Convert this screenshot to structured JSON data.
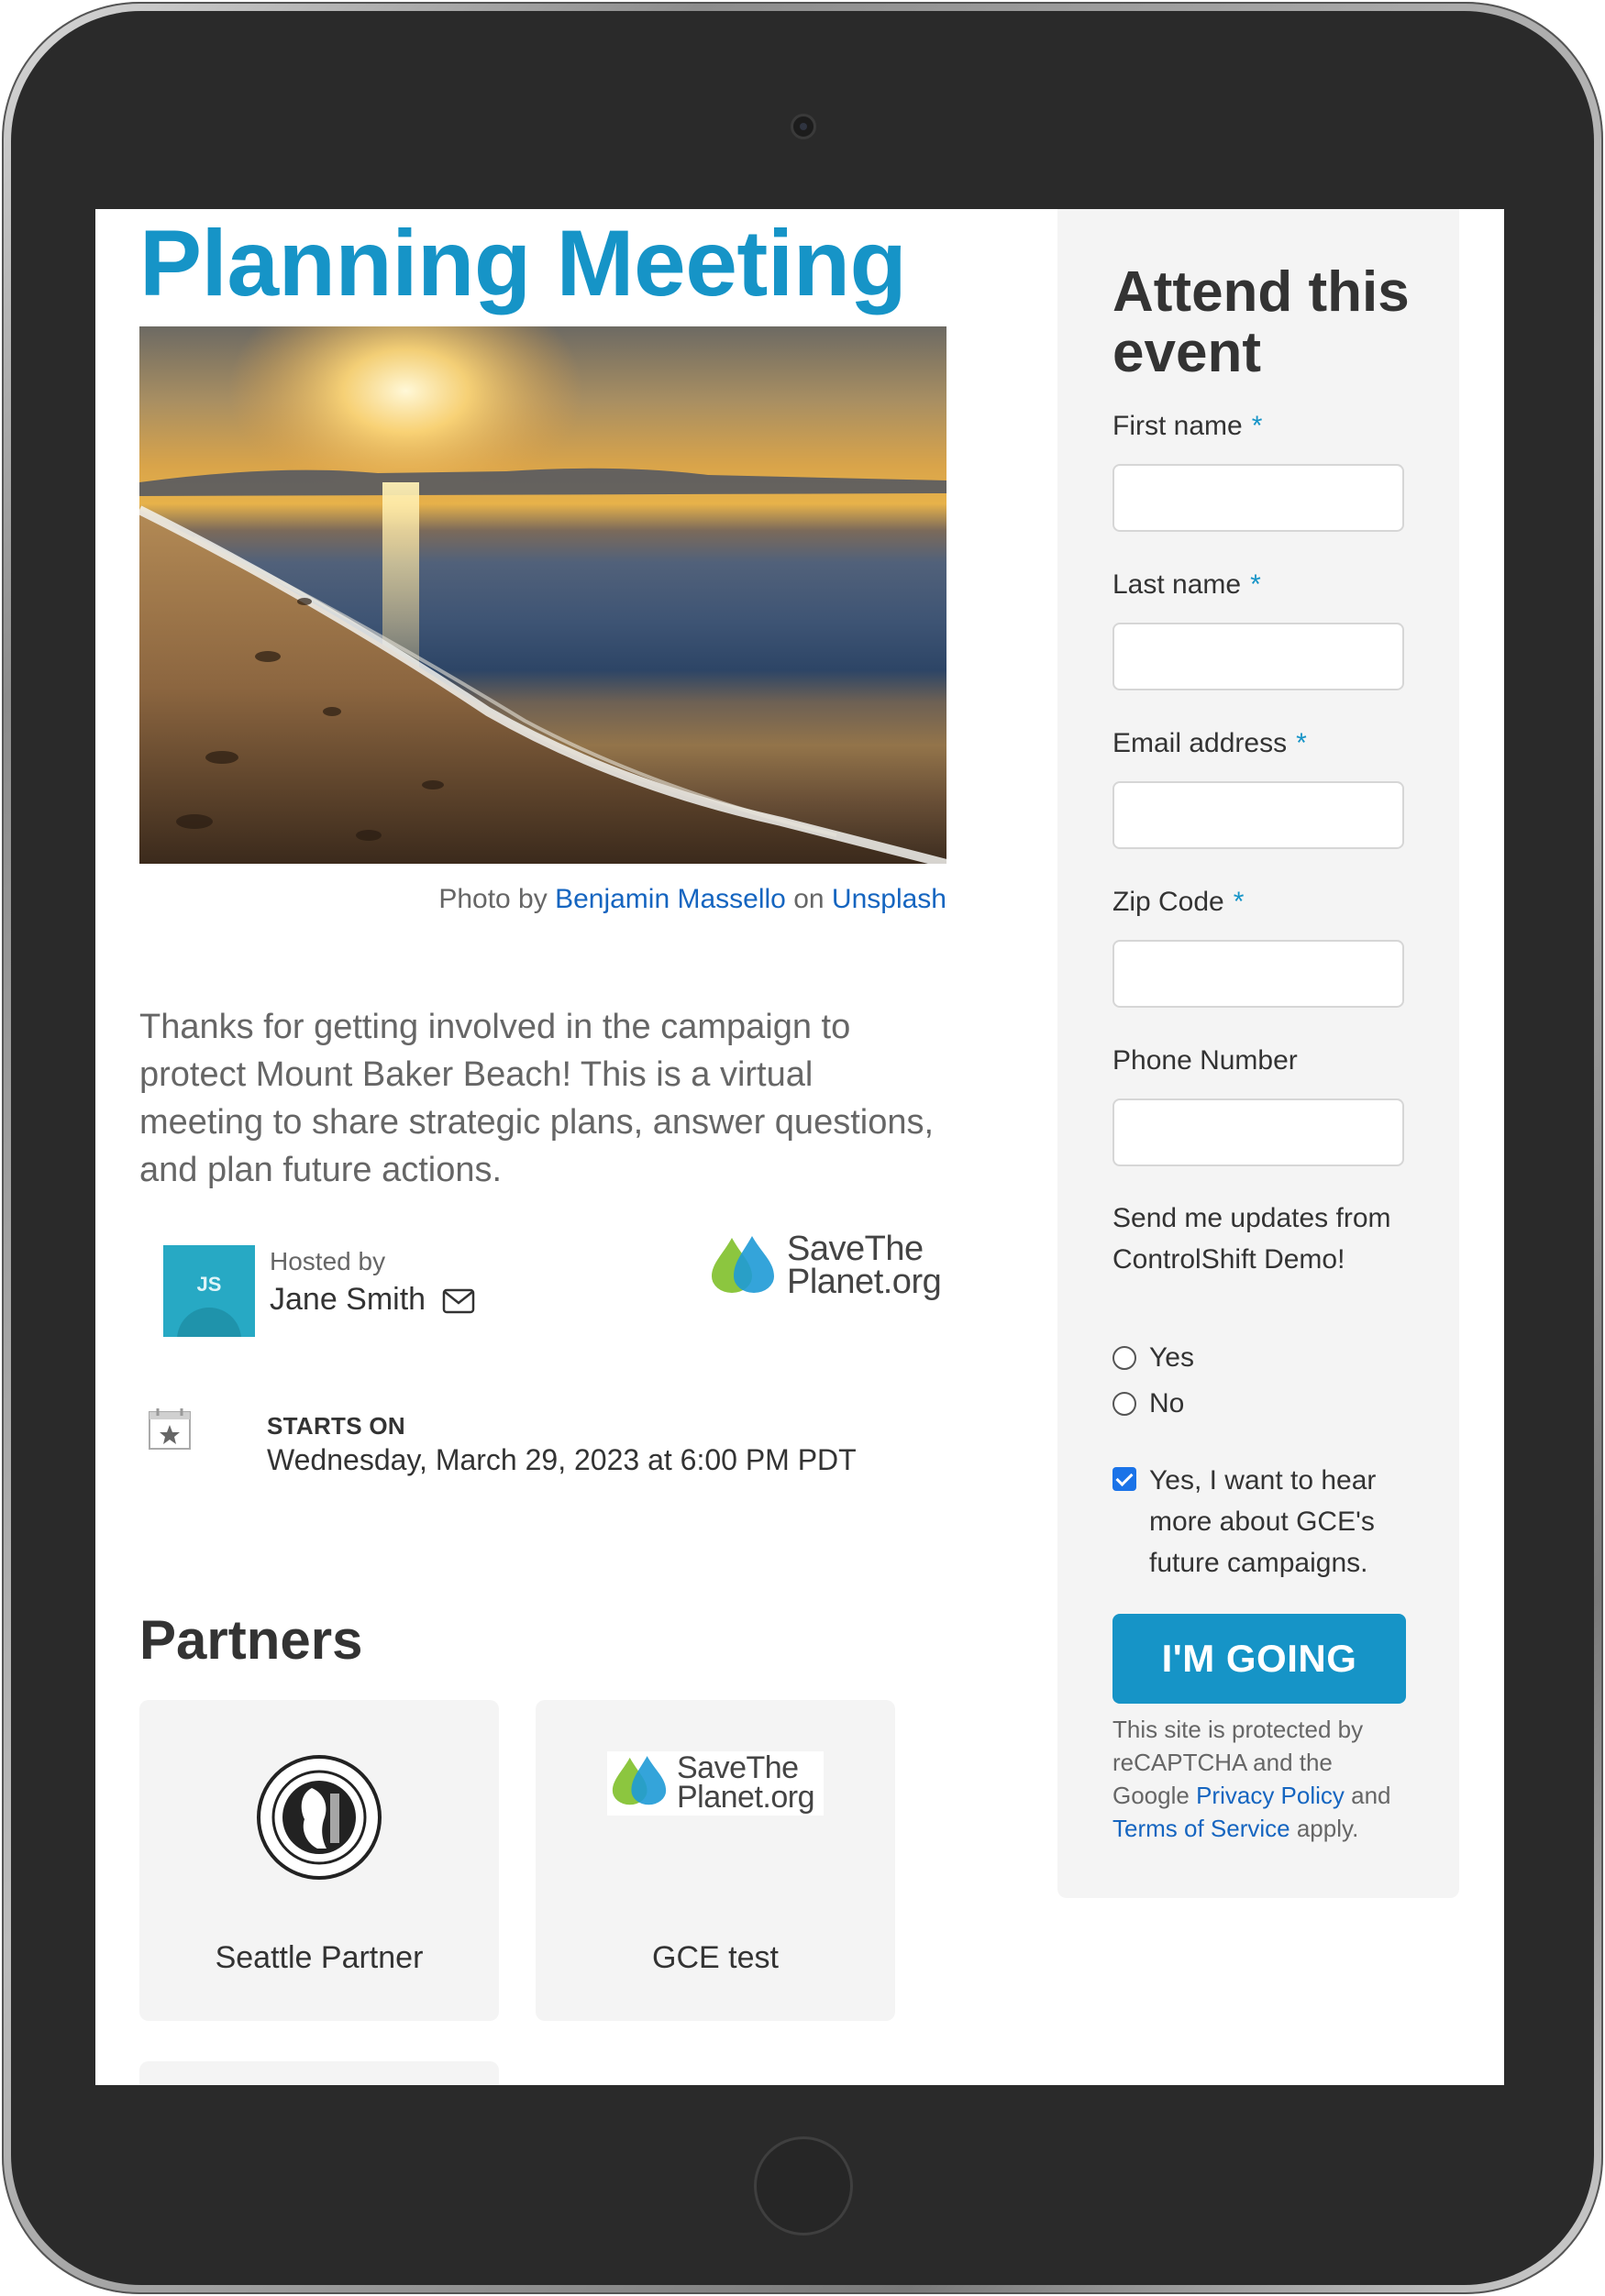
{
  "event": {
    "title": "Planning Meeting",
    "photo_credit": {
      "prefix": "Photo by",
      "photographer": "Benjamin Massello",
      "connector": "on",
      "source": "Unsplash"
    },
    "description": "Thanks for getting involved in the campaign to protect Mount Baker Beach! This is a virtual meeting to share strategic plans, answer questions, and plan future actions.",
    "host": {
      "label": "Hosted by",
      "initials": "JS",
      "name": "Jane Smith"
    },
    "organization_logo": {
      "line1": "SaveThe",
      "line2": "Planet.org"
    },
    "schedule": {
      "label": "STARTS ON",
      "value": "Wednesday, March 29, 2023 at 6:00 PM PDT"
    }
  },
  "partners": {
    "heading": "Partners",
    "items": [
      {
        "name": "Seattle Partner",
        "logo": "city-of-seattle-seal"
      },
      {
        "name": "GCE test",
        "logo": "savetheplanet-logo",
        "logo_line1": "SaveThe",
        "logo_line2": "Planet.org"
      }
    ]
  },
  "form": {
    "title": "Attend this event",
    "required_marker": "*",
    "fields": {
      "first_name": {
        "label": "First name",
        "value": ""
      },
      "last_name": {
        "label": "Last name",
        "value": ""
      },
      "email": {
        "label": "Email address",
        "value": ""
      },
      "zip": {
        "label": "Zip Code",
        "value": ""
      },
      "phone": {
        "label": "Phone Number",
        "value": ""
      }
    },
    "updates_question": "Send me updates from ControlShift Demo!",
    "radio_options": [
      "Yes",
      "No"
    ],
    "opt_in_label": "Yes, I want to hear more about GCE's future campaigns.",
    "opt_in_checked": true,
    "submit_label": "I'M GOING",
    "recaptcha": {
      "text_before": "This site is protected by reCAPTCHA and the Google",
      "privacy_link": "Privacy Policy",
      "and": "and",
      "terms_link": "Terms of Service",
      "text_after": "apply."
    }
  },
  "colors": {
    "brand": "#1694c7",
    "link": "#1565c0",
    "panel": "#f4f4f4"
  }
}
